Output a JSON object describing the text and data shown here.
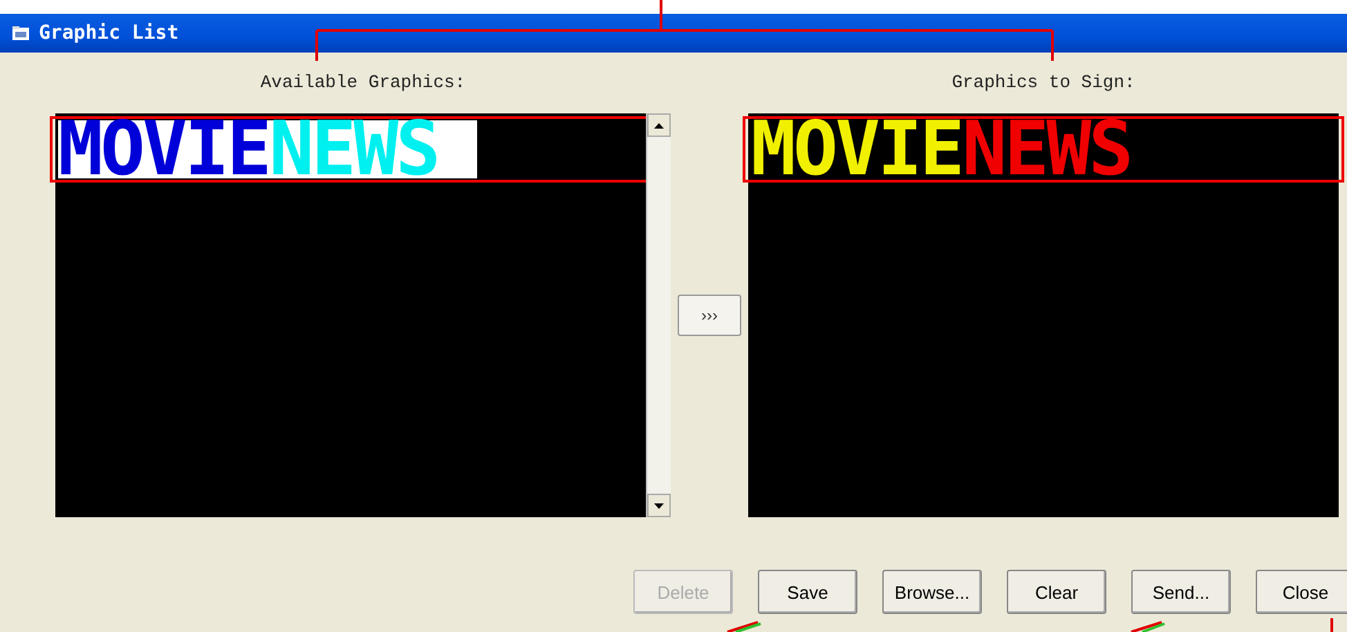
{
  "window": {
    "title": "Graphic List"
  },
  "available": {
    "label": "Available Graphics:",
    "items": [
      {
        "selected": true,
        "segments": [
          {
            "text": "MOVIE",
            "color": "#0000d8"
          },
          {
            "text": "NEWS",
            "color": "#00f0f0"
          }
        ]
      }
    ]
  },
  "move_button": "›››",
  "to_sign": {
    "label": "Graphics to Sign:",
    "items": [
      {
        "selected": false,
        "segments": [
          {
            "text": "MOVIE",
            "color": "#f0f000"
          },
          {
            "text": "NEWS",
            "color": "#f00000"
          }
        ]
      }
    ]
  },
  "buttons": [
    {
      "label": "Delete",
      "disabled": true
    },
    {
      "label": "Save",
      "disabled": false
    },
    {
      "label": "Browse...",
      "disabled": false
    },
    {
      "label": "Clear",
      "disabled": false
    },
    {
      "label": "Send...",
      "disabled": false
    },
    {
      "label": "Close",
      "disabled": false
    }
  ]
}
